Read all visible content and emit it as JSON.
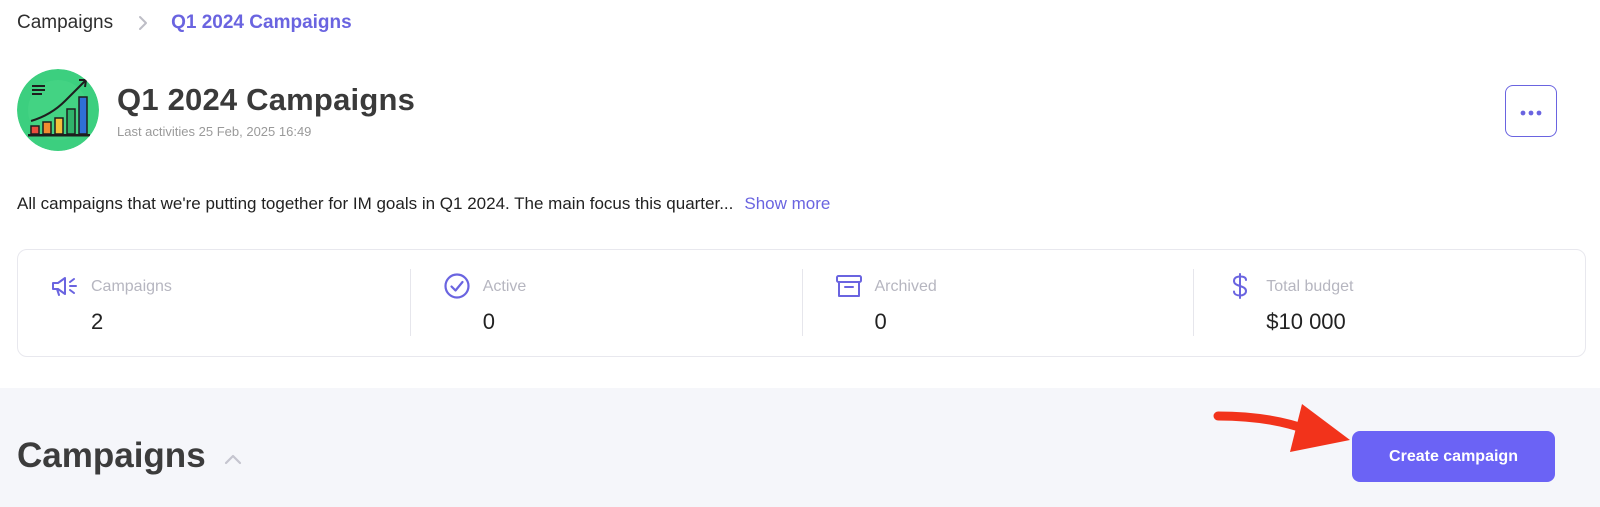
{
  "breadcrumb": {
    "root": "Campaigns",
    "separator_icon": "chevron-right-icon",
    "current": "Q1 2024 Campaigns"
  },
  "header": {
    "avatar_icon": "growth-chart-icon",
    "title": "Q1 2024 Campaigns",
    "subtitle": "Last activities 25 Feb, 2025 16:49",
    "more_icon": "more-horizontal-icon"
  },
  "description": {
    "text": "All campaigns that we're putting together for IM goals in Q1 2024. The main focus this quarter...",
    "show_more": "Show more"
  },
  "stats": [
    {
      "icon": "megaphone-icon",
      "label": "Campaigns",
      "value": "2"
    },
    {
      "icon": "check-circle-icon",
      "label": "Active",
      "value": "0"
    },
    {
      "icon": "archive-icon",
      "label": "Archived",
      "value": "0"
    },
    {
      "icon": "dollar-icon",
      "label": "Total budget",
      "value": "$10 000"
    }
  ],
  "section": {
    "title": "Campaigns",
    "toggle_icon": "chevron-up-icon",
    "create_button": "Create campaign"
  },
  "colors": {
    "accent": "#6a64e0",
    "button": "#6b63f5",
    "annotation_arrow": "#f2331b",
    "bottom_background": "#f5f6fa"
  }
}
